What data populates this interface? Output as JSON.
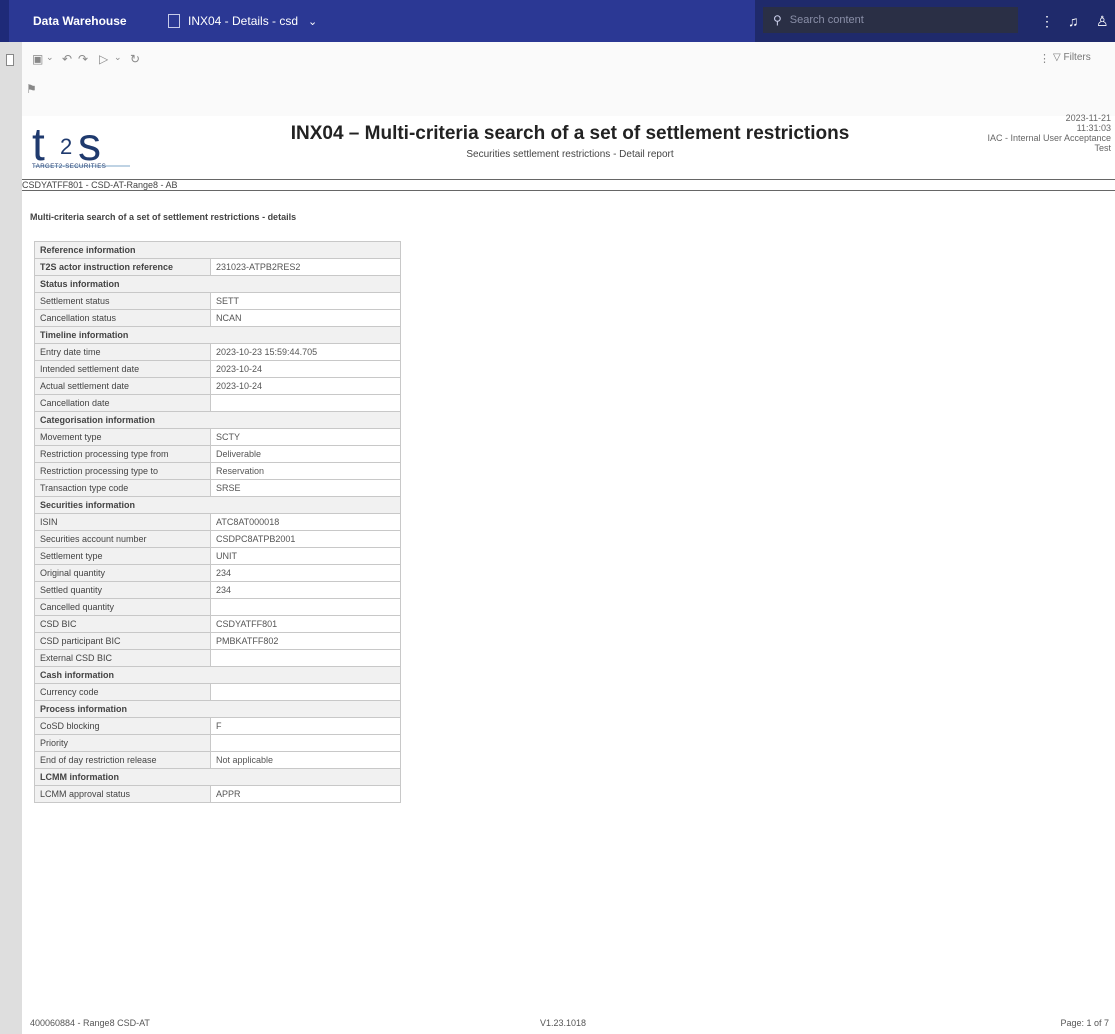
{
  "app": {
    "brand": "Data Warehouse",
    "report_tab_label": "INX04 - Details - csd",
    "search_placeholder": "Search content"
  },
  "toolbar": {
    "filters_label": "Filters"
  },
  "report": {
    "title": "INX04 – Multi-criteria search of a set of settlement restrictions",
    "subtitle": "Securities settlement restrictions - Detail report",
    "date": "2023-11-21",
    "time": "11:31:03",
    "env_line1": "IAC - Internal User Acceptance",
    "env_line2": "Test",
    "party": "CSDYATFF801 - CSD-AT-Range8 - AB",
    "section_title": "Multi-criteria search of a set of settlement restrictions - details",
    "logo_tagline": "TARGET2-SECURITIES"
  },
  "details": {
    "reference_group": "Reference information",
    "t2s_ref_label": "T2S actor instruction reference",
    "t2s_ref_value": "231023-ATPB2RES2",
    "status_group": "Status information",
    "settlement_status_label": "Settlement status",
    "settlement_status_value": "SETT",
    "cancellation_status_label": "Cancellation status",
    "cancellation_status_value": "NCAN",
    "timeline_group": "Timeline information",
    "entry_datetime_label": "Entry date time",
    "entry_datetime_value": "2023-10-23 15:59:44.705",
    "intended_date_label": "Intended settlement date",
    "intended_date_value": "2023-10-24",
    "actual_date_label": "Actual settlement date",
    "actual_date_value": "2023-10-24",
    "cancellation_date_label": "Cancellation date",
    "cancellation_date_value": "",
    "categorisation_group": "Categorisation information",
    "movement_type_label": "Movement type",
    "movement_type_value": "SCTY",
    "proc_type_from_label": "Restriction processing type from",
    "proc_type_from_value": "Deliverable",
    "proc_type_to_label": "Restriction processing type to",
    "proc_type_to_value": "Reservation",
    "transaction_type_label": "Transaction type code",
    "transaction_type_value": "SRSE",
    "securities_group": "Securities information",
    "isin_label": "ISIN",
    "isin_value": "ATC8AT000018",
    "account_label": "Securities account number",
    "account_value": "CSDPC8ATPB2001",
    "settlement_type_label": "Settlement type",
    "settlement_type_value": "UNIT",
    "original_qty_label": "Original quantity",
    "original_qty_value": "234",
    "settled_qty_label": "Settled quantity",
    "settled_qty_value": "234",
    "cancelled_qty_label": "Cancelled quantity",
    "cancelled_qty_value": "",
    "csd_bic_label": "CSD BIC",
    "csd_bic_value": "CSDYATFF801",
    "participant_bic_label": "CSD participant BIC",
    "participant_bic_value": "PMBKATFF802",
    "external_bic_label": "External CSD BIC",
    "external_bic_value": "",
    "cash_group": "Cash information",
    "currency_label": "Currency code",
    "currency_value": "",
    "process_group": "Process information",
    "cosd_label": "CoSD blocking",
    "cosd_value": "F",
    "priority_label": "Priority",
    "priority_value": "",
    "eod_label": "End of day restriction release",
    "eod_value": "Not applicable",
    "lcmm_group": "LCMM information",
    "lcmm_label": "LCMM approval status",
    "lcmm_value": "APPR"
  },
  "footer": {
    "left": "400060884 - Range8 CSD-AT",
    "center": "V1.23.1018",
    "right": "Page: 1 of 7"
  }
}
